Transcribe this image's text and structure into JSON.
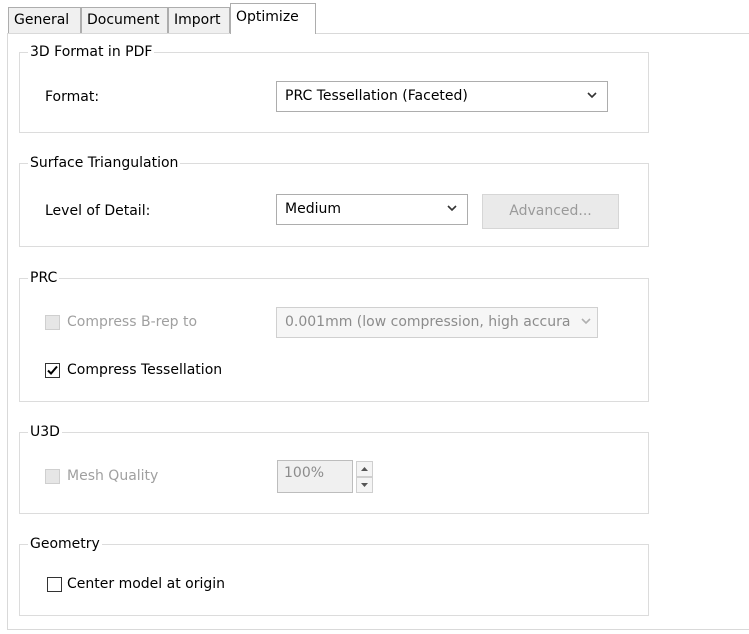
{
  "tabs": [
    {
      "label": "General"
    },
    {
      "label": "Document"
    },
    {
      "label": "Import"
    },
    {
      "label": "Optimize",
      "active": true
    }
  ],
  "format_group": {
    "legend": "3D Format in PDF",
    "format_label": "Format:",
    "format_value": "PRC Tessellation (Faceted)"
  },
  "triangulation_group": {
    "legend": "Surface Triangulation",
    "detail_label": "Level of Detail:",
    "detail_value": "Medium",
    "advanced_label": "Advanced..."
  },
  "prc_group": {
    "legend": "PRC",
    "compress_brep_label": "Compress B-rep to",
    "compress_brep_checked": false,
    "compress_brep_value": "0.001mm (low compression, high accura",
    "compress_tess_label": "Compress Tessellation",
    "compress_tess_checked": true
  },
  "u3d_group": {
    "legend": "U3D",
    "mesh_quality_label": "Mesh Quality",
    "mesh_quality_checked": false,
    "mesh_quality_value": "100%"
  },
  "geometry_group": {
    "legend": "Geometry",
    "center_model_label": "Center model at origin",
    "center_model_checked": false
  },
  "icons": {
    "dropdown": "chevron-down-icon",
    "spin_up": "arrow-up-icon",
    "spin_down": "arrow-down-icon",
    "check": "checkmark-icon"
  }
}
